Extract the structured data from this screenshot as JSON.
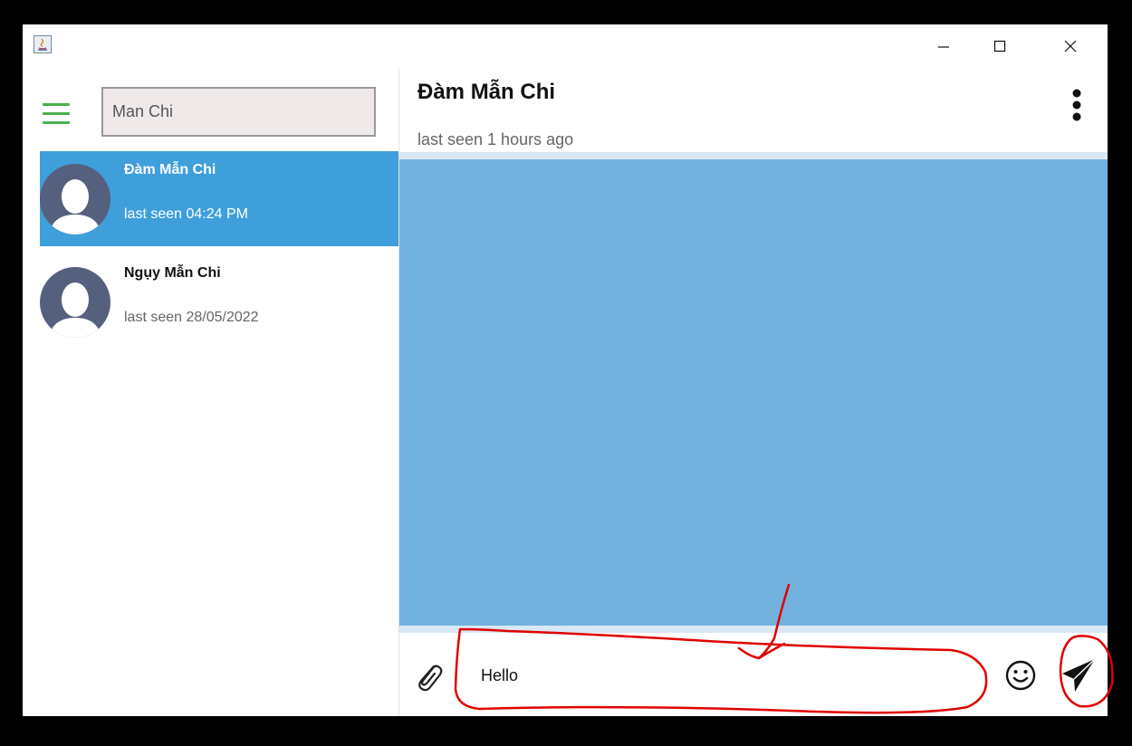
{
  "window": {
    "controls": {
      "minimize": "—",
      "maximize": "☐",
      "close": "✕"
    }
  },
  "sidebar": {
    "search_value": "Man Chi",
    "contacts": [
      {
        "name": "Đàm Mẫn Chi",
        "last_seen": "last seen 04:24 PM",
        "active": true
      },
      {
        "name": "Ngụy Mẫn Chi",
        "last_seen": "last seen 28/05/2022",
        "active": false
      }
    ]
  },
  "chat": {
    "title": "Đàm Mẫn Chi",
    "last_seen": "last seen 1 hours ago",
    "input_value": "Hello"
  },
  "colors": {
    "accent": "#3f9fdb",
    "message_area": "#73b2df",
    "menu_icon": "#4caf50",
    "annotation": "#e00000"
  },
  "icons": [
    "java-app-icon",
    "hamburger-menu-icon",
    "more-vert-icon",
    "paperclip-icon",
    "smiley-icon",
    "send-icon"
  ]
}
